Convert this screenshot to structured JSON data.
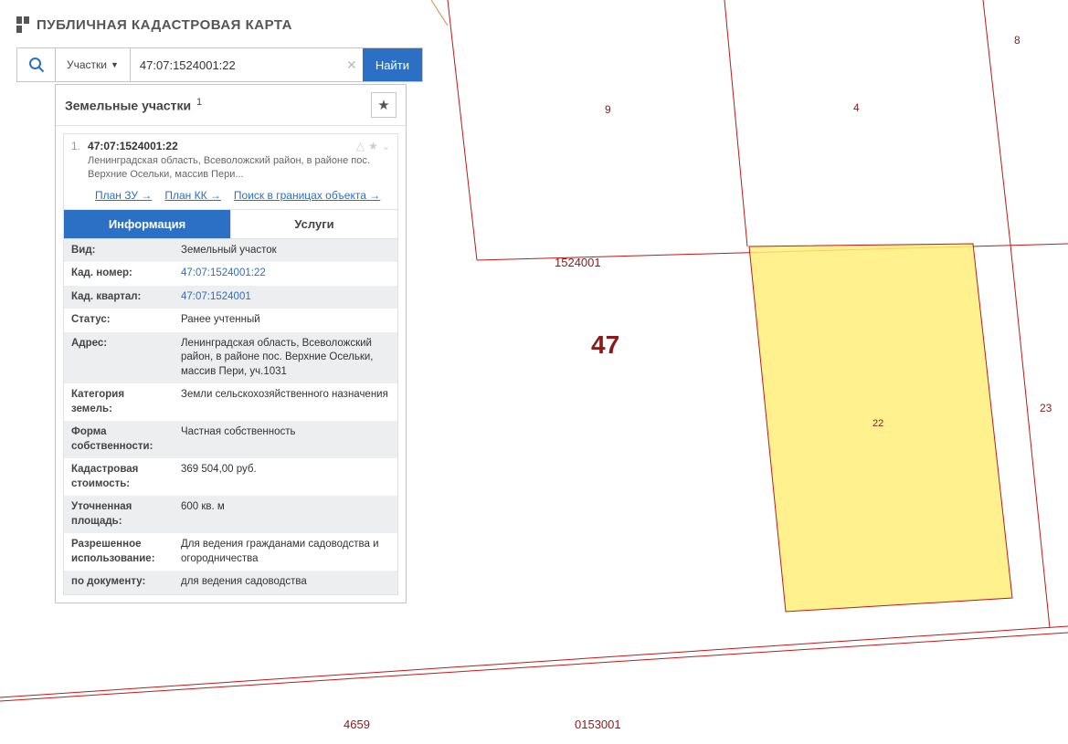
{
  "header": {
    "title": "ПУБЛИЧНАЯ КАДАСТРОВАЯ КАРТА"
  },
  "search": {
    "type_label": "Участки",
    "value": "47:07:1524001:22",
    "placeholder": "",
    "button": "Найти"
  },
  "panel": {
    "title": "Земельные участки",
    "count": "1"
  },
  "card": {
    "index": "1.",
    "cad_num": "47:07:1524001:22",
    "address_short": "Ленинградская область, Всеволожский район, в районе пос. Верхние Осельки, массив Пери...",
    "links": {
      "plan_zu": "План ЗУ →",
      "plan_kk": "План КК →",
      "search_in": "Поиск в границах объекта →"
    },
    "tabs": {
      "info": "Информация",
      "services": "Услуги"
    },
    "props": [
      {
        "key": "Вид:",
        "val": "Земельный участок",
        "link": false
      },
      {
        "key": "Кад. номер:",
        "val": "47:07:1524001:22",
        "link": true
      },
      {
        "key": "Кад. квартал:",
        "val": "47:07:1524001",
        "link": true
      },
      {
        "key": "Статус:",
        "val": "Ранее учтенный",
        "link": false
      },
      {
        "key": "Адрес:",
        "val": "Ленинградская область, Всеволожский район, в районе пос. Верхние Осельки, массив Пери, уч.1031",
        "link": false
      },
      {
        "key": "Категория земель:",
        "val": "Земли сельскохозяйственного назначения",
        "link": false
      },
      {
        "key": "Форма собственности:",
        "val": "Частная собственность",
        "link": false
      },
      {
        "key": "Кадастровая стоимость:",
        "val": "369 504,00 руб.",
        "link": false
      },
      {
        "key": "Уточненная площадь:",
        "val": "600 кв. м",
        "link": false
      },
      {
        "key": "Разрешенное использование:",
        "val": "Для ведения гражданами садоводства и огородничества",
        "link": false
      },
      {
        "key": "по документу:",
        "val": "для ведения садоводства",
        "link": false
      }
    ]
  },
  "map": {
    "region_label": "47",
    "labels": [
      "9",
      "4",
      "8",
      "1524001",
      "22",
      "23",
      "4659",
      "0153001"
    ]
  }
}
